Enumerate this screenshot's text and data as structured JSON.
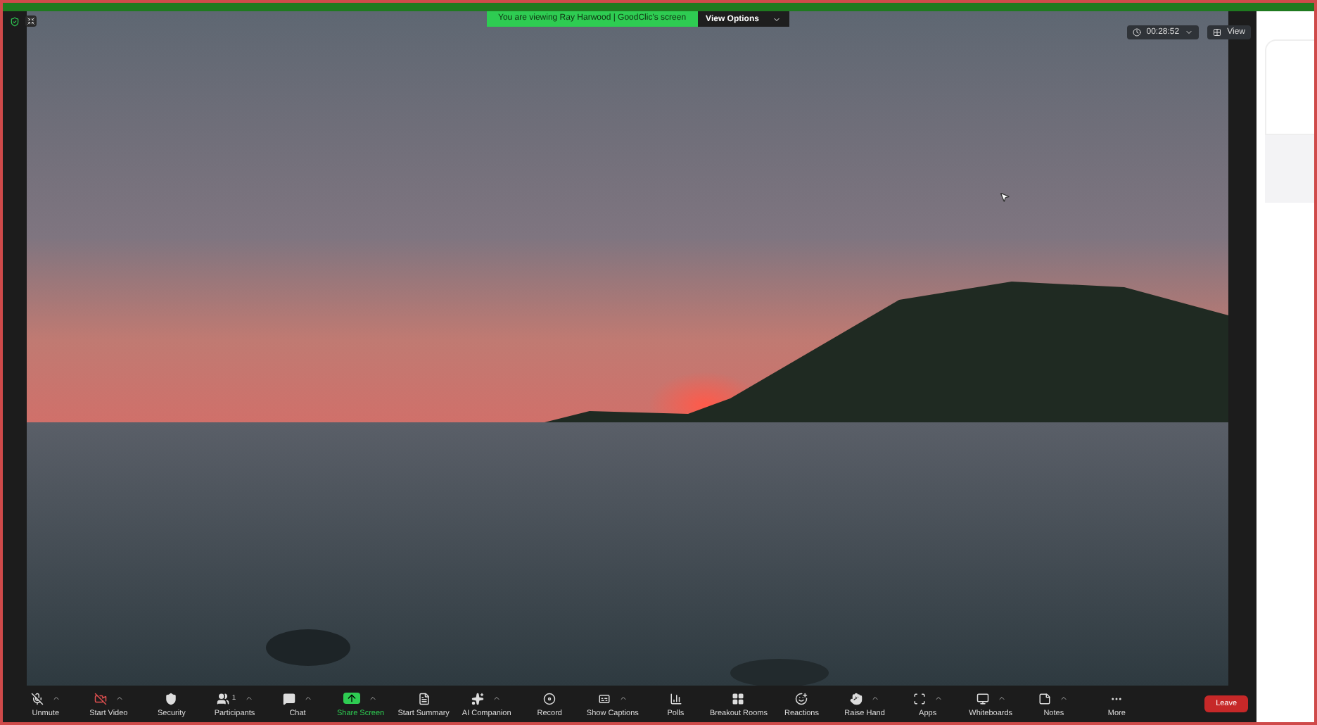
{
  "top_bar": {
    "banner": "You are viewing Ray Harwood | GoodClic's screen",
    "view_options": "View Options",
    "timer": "00:28:52",
    "view": "View"
  },
  "toolbar": {
    "items": [
      {
        "kind": "mic",
        "label": "Unmute",
        "off": true,
        "caret": true
      },
      {
        "kind": "video",
        "label": "Start Video",
        "off": true,
        "caret": true
      },
      {
        "kind": "security",
        "label": "Security",
        "off": false,
        "caret": false
      },
      {
        "kind": "participants",
        "label": "Participants",
        "count": "1",
        "off": false,
        "caret": true
      },
      {
        "kind": "chat",
        "label": "Chat",
        "off": false,
        "caret": true
      },
      {
        "kind": "share",
        "label": "Share Screen",
        "off": false,
        "caret": true
      },
      {
        "kind": "summary",
        "label": "Start Summary",
        "off": false,
        "caret": false
      },
      {
        "kind": "ai",
        "label": "AI Companion",
        "off": false,
        "caret": true
      },
      {
        "kind": "record",
        "label": "Record",
        "off": false,
        "caret": false
      },
      {
        "kind": "captions",
        "label": "Show Captions",
        "off": false,
        "caret": true
      },
      {
        "kind": "polls",
        "label": "Polls",
        "off": false,
        "caret": false
      },
      {
        "kind": "rooms",
        "label": "Breakout Rooms",
        "off": false,
        "caret": false
      },
      {
        "kind": "reactions",
        "label": "Reactions",
        "off": false,
        "caret": false
      },
      {
        "kind": "hand",
        "label": "Raise Hand",
        "off": false,
        "caret": true
      },
      {
        "kind": "apps",
        "label": "Apps",
        "off": false,
        "caret": true
      },
      {
        "kind": "whiteboards",
        "label": "Whiteboards",
        "off": false,
        "caret": true
      },
      {
        "kind": "notes",
        "label": "Notes",
        "off": false,
        "caret": true
      },
      {
        "kind": "more",
        "label": "More",
        "off": false,
        "caret": false
      }
    ],
    "leave": "Leave"
  }
}
